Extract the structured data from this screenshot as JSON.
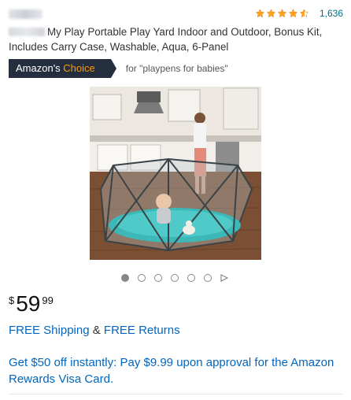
{
  "product": {
    "rating_count": "1,636",
    "title": "My Play Portable Play Yard Indoor and Outdoor, Bonus Kit, Includes Carry Case, Washable, Aqua, 6-Panel"
  },
  "badge": {
    "label_prefix": "Amazon's",
    "label_highlight": "Choice",
    "for_text": "for \"playpens for babies\"",
    "background_color": "#232f3e",
    "highlight_color": "#ff9900"
  },
  "carousel": {
    "image_count": 6,
    "active_index": 0,
    "icons": [
      "dot-icon",
      "play-icon"
    ]
  },
  "price": {
    "currency": "$",
    "whole": "59",
    "fraction": "99"
  },
  "shipping": {
    "free_shipping": "FREE Shipping",
    "separator": "&",
    "free_returns": "FREE Returns"
  },
  "promo": {
    "text": "Get $50 off instantly: Pay $9.99 upon approval for the Amazon Rewards Visa Card."
  },
  "colors": {
    "link": "#0066c0",
    "star": "#ffa41c"
  }
}
